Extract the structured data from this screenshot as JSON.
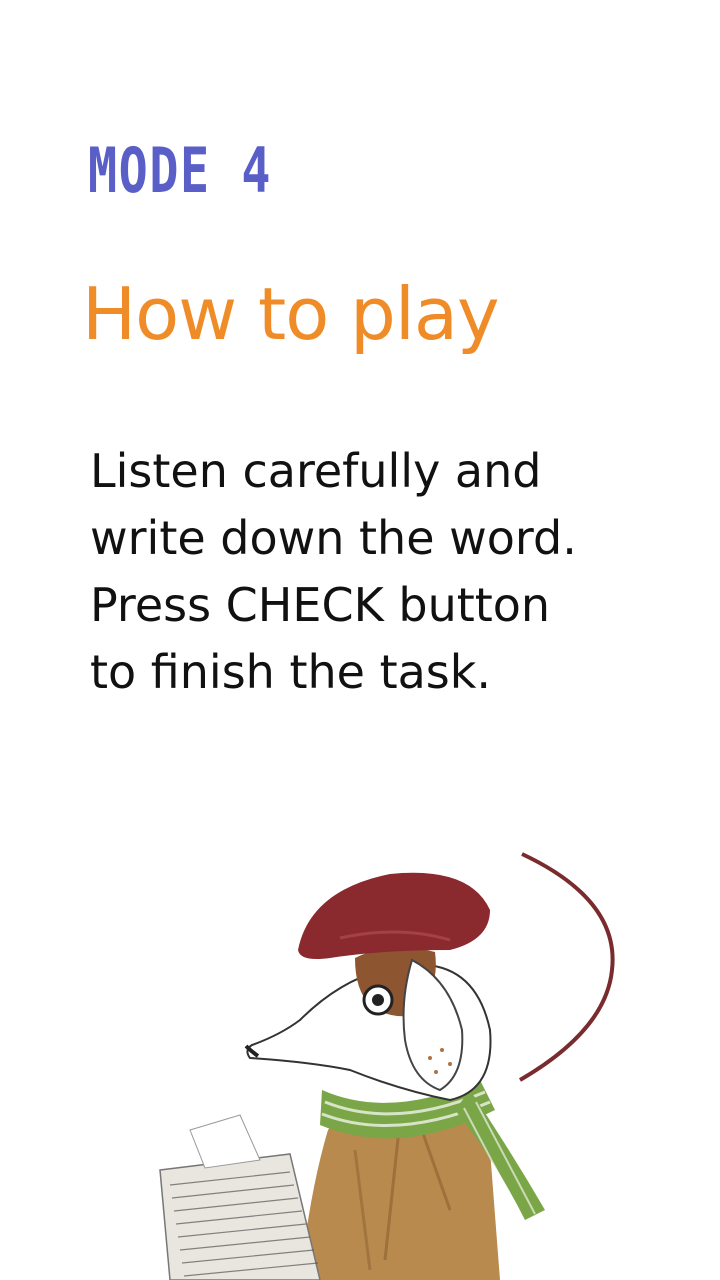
{
  "header": {
    "mode_label": "MODE 4",
    "title": "How to play"
  },
  "instructions": {
    "lines": [
      "Listen carefully and",
      "write down the word.",
      "Press CHECK button",
      "to finish the task."
    ]
  },
  "illustration": {
    "icon": "dog-reading-newspaper-illustration",
    "colors": {
      "cap": "#8a2a2f",
      "scarf": "#6e9a3a",
      "coat": "#b98a4e",
      "ear": "#8d5530",
      "arc": "#7a2b2e"
    }
  }
}
